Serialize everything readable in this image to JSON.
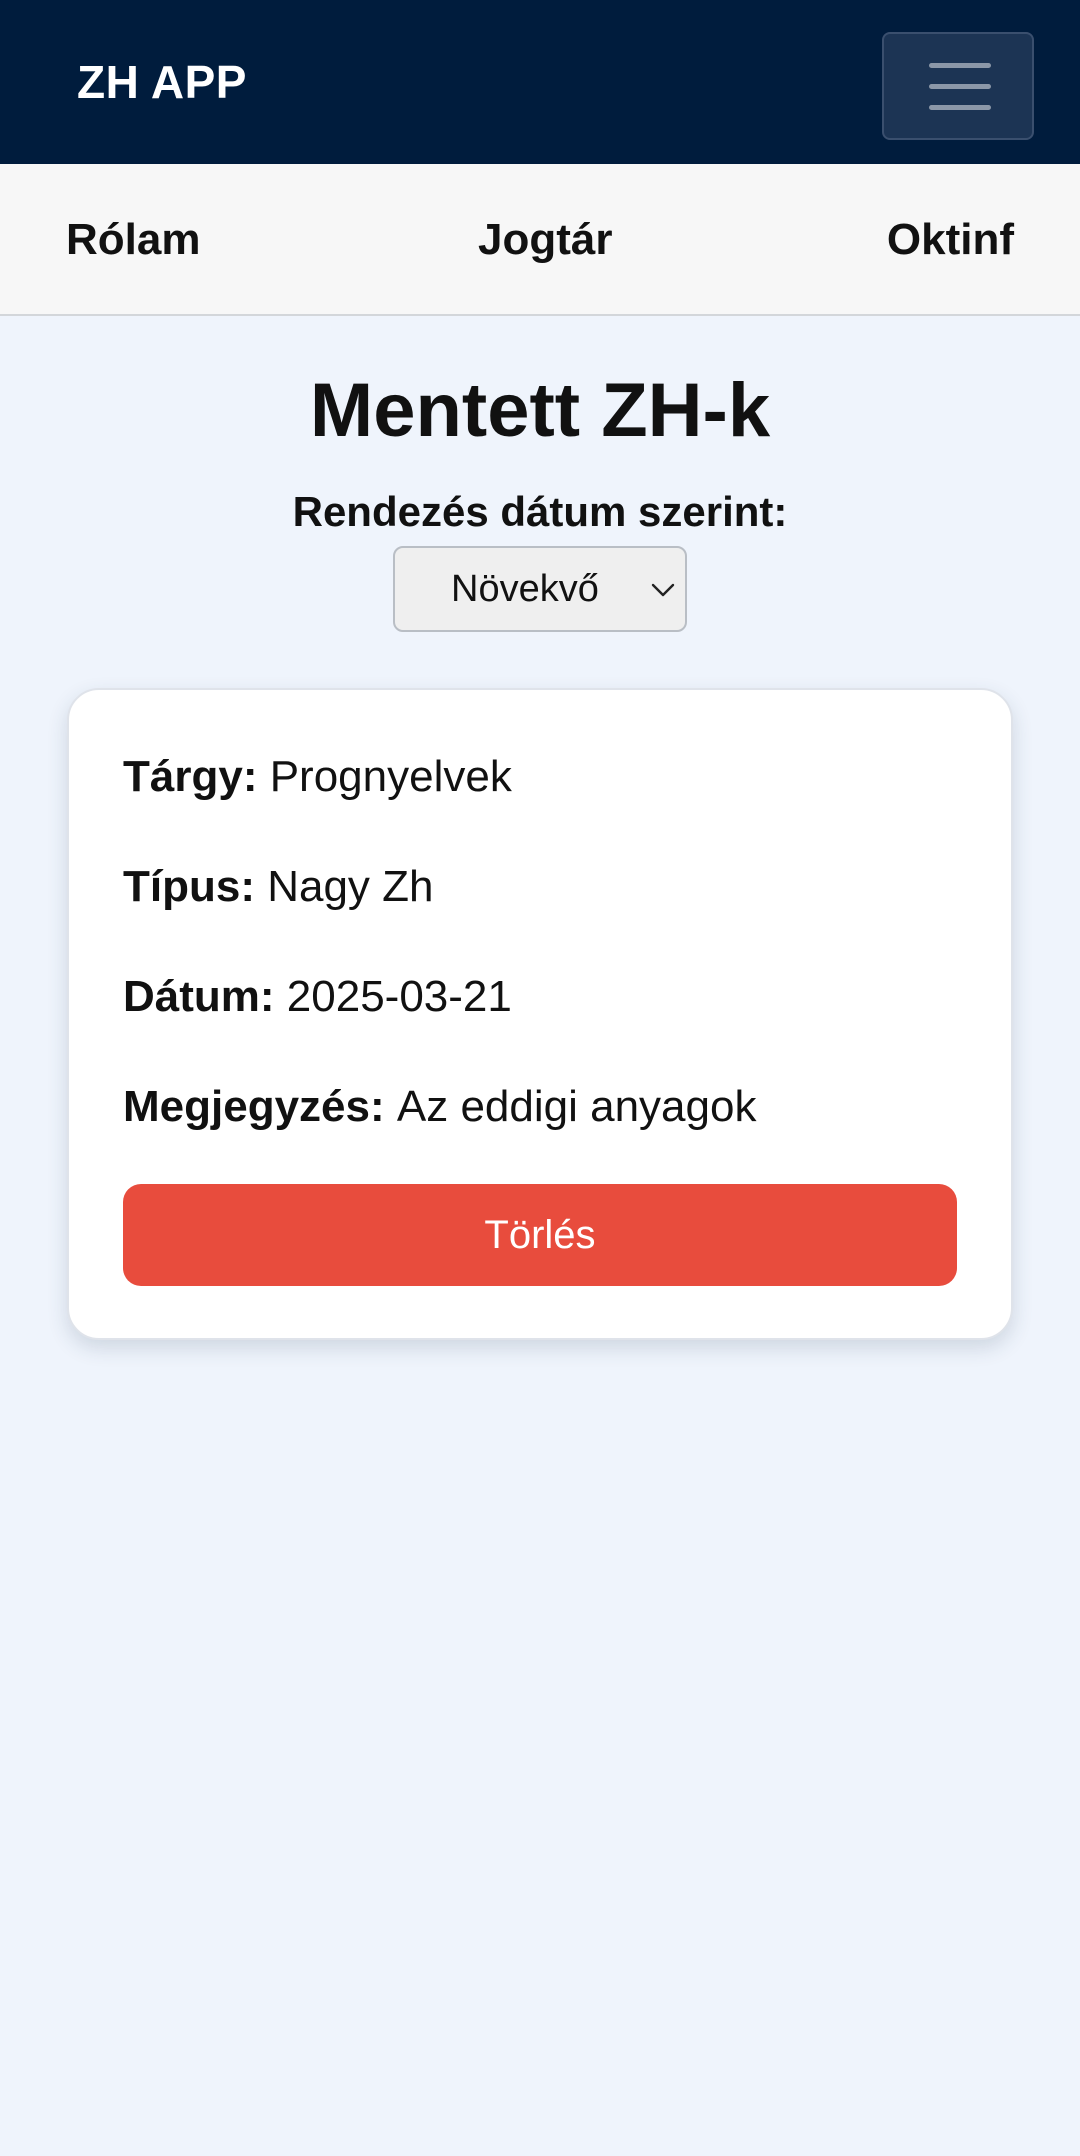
{
  "header": {
    "brand": "ZH APP",
    "menu_icon": "hamburger-menu-icon",
    "background_color": "#001c3d"
  },
  "nav": {
    "items": [
      {
        "label": "Rólam"
      },
      {
        "label": "Jogtár"
      },
      {
        "label": "Oktinf"
      }
    ]
  },
  "main": {
    "title": "Mentett ZH-k",
    "sort_label": "Rendezés dátum szerint:",
    "sort_select": {
      "selected": "Növekvő",
      "icon": "chevron-down-icon"
    }
  },
  "entries": [
    {
      "subject_label": "Tárgy:",
      "subject": "Prognyelvek",
      "type_label": "Típus:",
      "type": "Nagy Zh",
      "date_label": "Dátum:",
      "date": "2025-03-21",
      "note_label": "Megjegyzés:",
      "note": "Az eddigi anyagok",
      "delete_label": "Törlés"
    }
  ],
  "colors": {
    "page_background": "#eff4fc",
    "delete_button": "#e84c3d"
  }
}
